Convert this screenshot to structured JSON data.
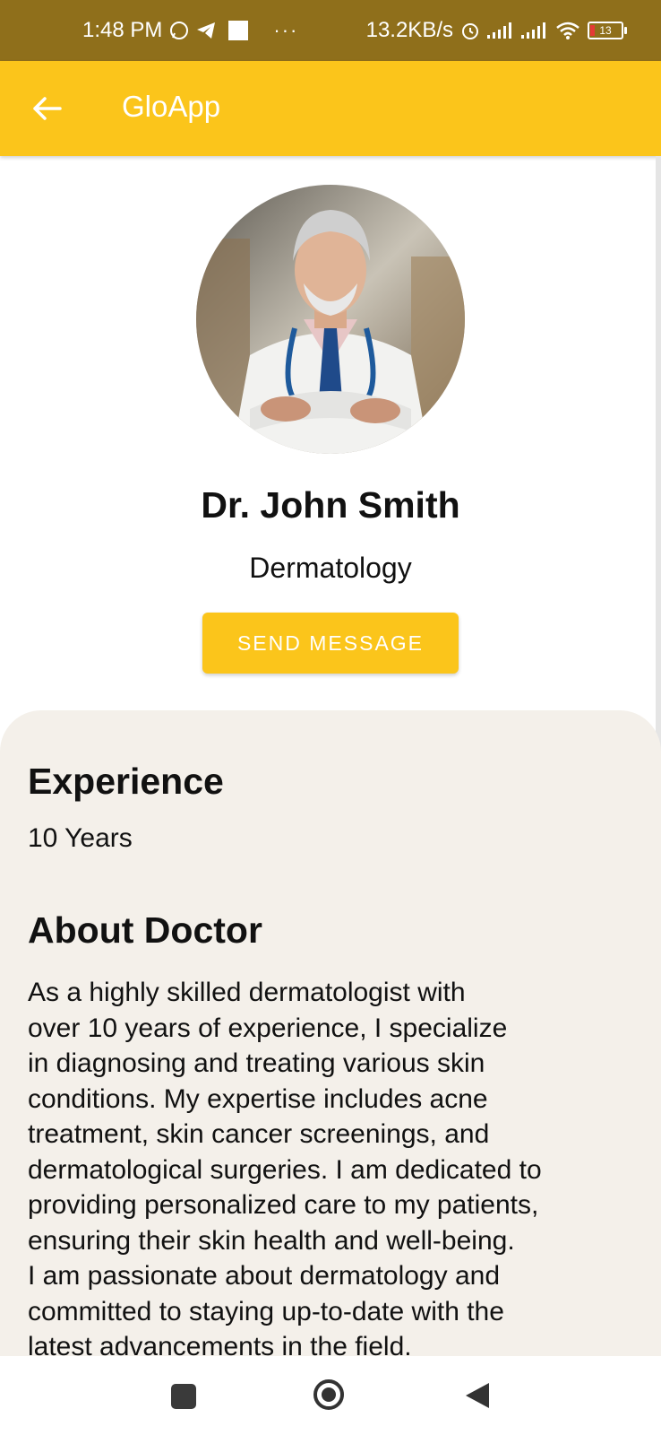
{
  "status_bar": {
    "time": "1:48 PM",
    "net_speed": "13.2KB/s",
    "battery": "13",
    "dots": "···"
  },
  "app_bar": {
    "title": "GloApp"
  },
  "doctor": {
    "name": "Dr. John Smith",
    "specialty": "Dermatology",
    "send_message_label": "SEND MESSAGE"
  },
  "experience": {
    "title": "Experience",
    "value": "10 Years"
  },
  "about": {
    "title": "About Doctor",
    "text": "As a highly skilled dermatologist with\nover 10 years of experience, I specialize\nin diagnosing and treating various skin\nconditions. My expertise includes acne\ntreatment, skin cancer screenings, and\ndermatological surgeries. I am dedicated to\nproviding personalized care to my patients,\nensuring their skin health and well-being.\nI am passionate about dermatology and\ncommitted to staying up-to-date with the\nlatest advancements in the field."
  },
  "colors": {
    "status_bar": "#8f6f1b",
    "accent": "#fbc51b",
    "card_bg": "#f4f0ea"
  }
}
